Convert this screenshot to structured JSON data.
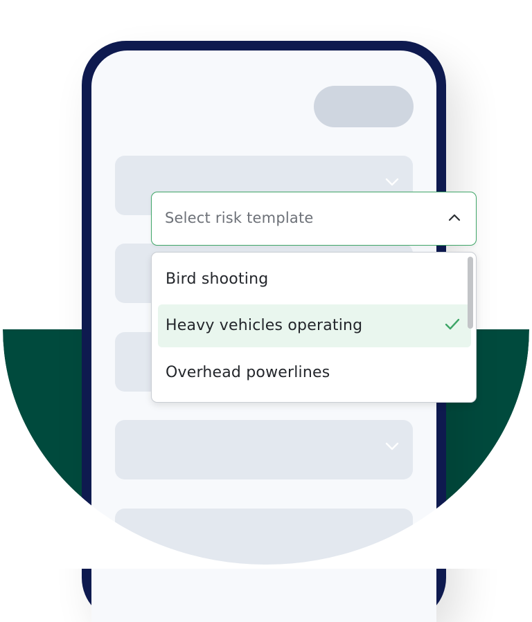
{
  "dropdown": {
    "placeholder": "Select risk template",
    "expanded": true
  },
  "options": [
    {
      "label": "Bird shooting",
      "selected": false
    },
    {
      "label": "Heavy vehicles operating",
      "selected": true
    },
    {
      "label": "Overhead powerlines",
      "selected": false
    }
  ],
  "colors": {
    "phone_frame": "#0e1a4f",
    "background_shape": "#004a3d",
    "accent_green": "#3ea567",
    "selected_bg": "#e9f6ee",
    "placeholder_field": "#e3e8ef"
  },
  "icons": {
    "dropdown_toggle": "chevron-up-icon",
    "field_toggle": "chevron-down-icon",
    "selected_mark": "check-icon"
  }
}
